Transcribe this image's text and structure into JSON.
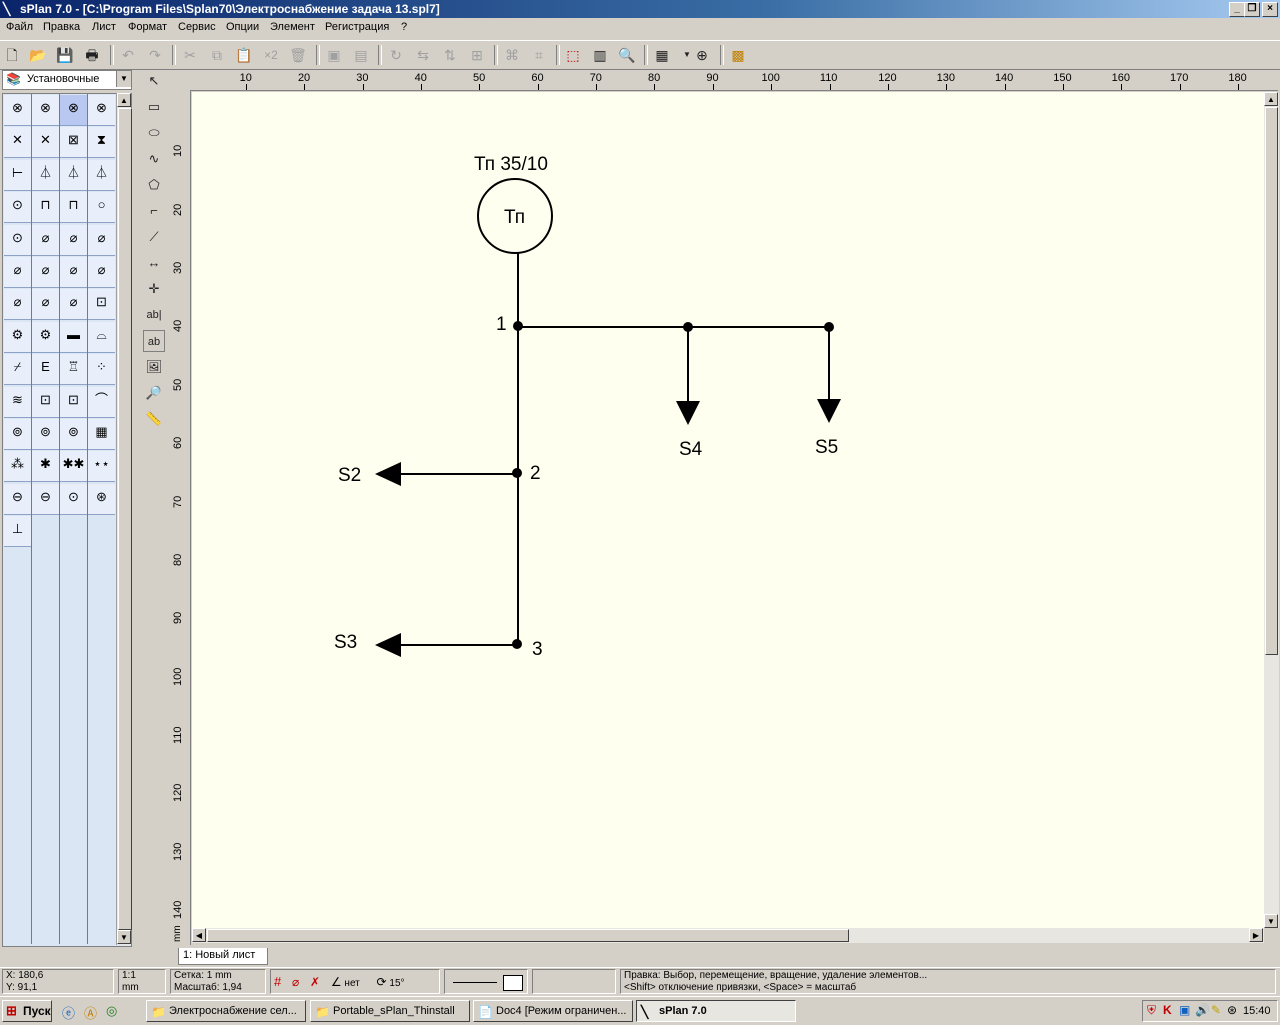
{
  "window": {
    "title": "sPlan 7.0 - [C:\\Program Files\\Splan70\\Электроснабжение задача 13.spl7]"
  },
  "menu": [
    "Файл",
    "Правка",
    "Лист",
    "Формат",
    "Сервис",
    "Опции",
    "Элемент",
    "Регистрация",
    "?"
  ],
  "toolbar": {
    "multiply_label": "×2"
  },
  "library": {
    "selected": "Установочные"
  },
  "tools": {
    "text_label_1": "ab|",
    "text_label_2": "ab"
  },
  "ruler": {
    "horizontal": [
      "10",
      "20",
      "30",
      "40",
      "50",
      "60",
      "70",
      "80",
      "90",
      "100",
      "110",
      "120",
      "130",
      "140",
      "150",
      "160",
      "170",
      "180"
    ],
    "vertical": [
      "10",
      "20",
      "30",
      "40",
      "50",
      "60",
      "70",
      "80",
      "90",
      "100",
      "110",
      "120",
      "130",
      "140"
    ],
    "unit": "mm"
  },
  "schematic": {
    "source_label": "Тп 35/10",
    "source_text": "Тп",
    "nodes": [
      "1",
      "2",
      "3"
    ],
    "loads": [
      "S2",
      "S3",
      "S4",
      "S5"
    ]
  },
  "sheets": [
    "1: Новый лист"
  ],
  "status": {
    "x": "X: 180,6",
    "y": "Y: 91,1",
    "scale_ratio": "1:1",
    "scale_unit": "mm",
    "grid": "Сетка: 1 mm",
    "zoom": "Масштаб:   1,94",
    "angle_mode": "нет",
    "rotate": "15°",
    "hint_line1": "Правка: Выбор, перемещение, вращение, удаление элементов...",
    "hint_line2": "<Shift> отключение привязки, <Space> = масштаб"
  },
  "taskbar": {
    "start": "Пуск",
    "tasks": [
      "Электроснабжение сел...",
      "Portable_sPlan_Thinstall",
      "Doc4 [Режим ограничен...",
      "sPlan 7.0"
    ],
    "clock": "15:40"
  }
}
